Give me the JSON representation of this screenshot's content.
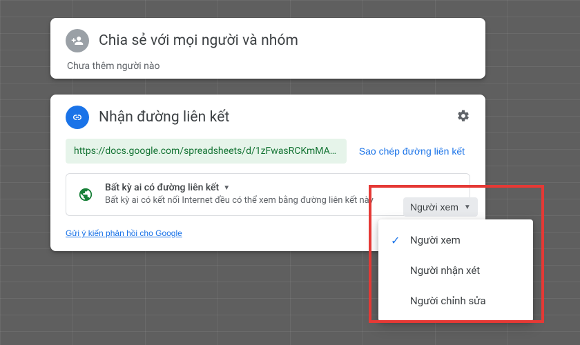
{
  "share": {
    "title": "Chia sẻ với mọi người và nhóm",
    "empty": "Chưa thêm người nào"
  },
  "link": {
    "title": "Nhận đường liên kết",
    "url": "https://docs.google.com/spreadsheets/d/1zFwasRCKmMAk...",
    "copy": "Sao chép đường liên kết",
    "access_title": "Bất kỳ ai có đường liên kết",
    "access_desc": "Bất kỳ ai có kết nối Internet đều có thể xem bằng đường liên kết này",
    "role_selected": "Người xem",
    "feedback": "Gửi ý kiến phản hồi cho Google"
  },
  "roles": {
    "viewer": "Người xem",
    "commenter": "Người nhận xét",
    "editor": "Người chỉnh sửa"
  },
  "icons": {
    "person_add": "person-add-icon",
    "link": "link-icon",
    "gear": "gear-icon",
    "globe": "globe-icon",
    "caret": "caret-down-icon",
    "check": "check-icon"
  }
}
